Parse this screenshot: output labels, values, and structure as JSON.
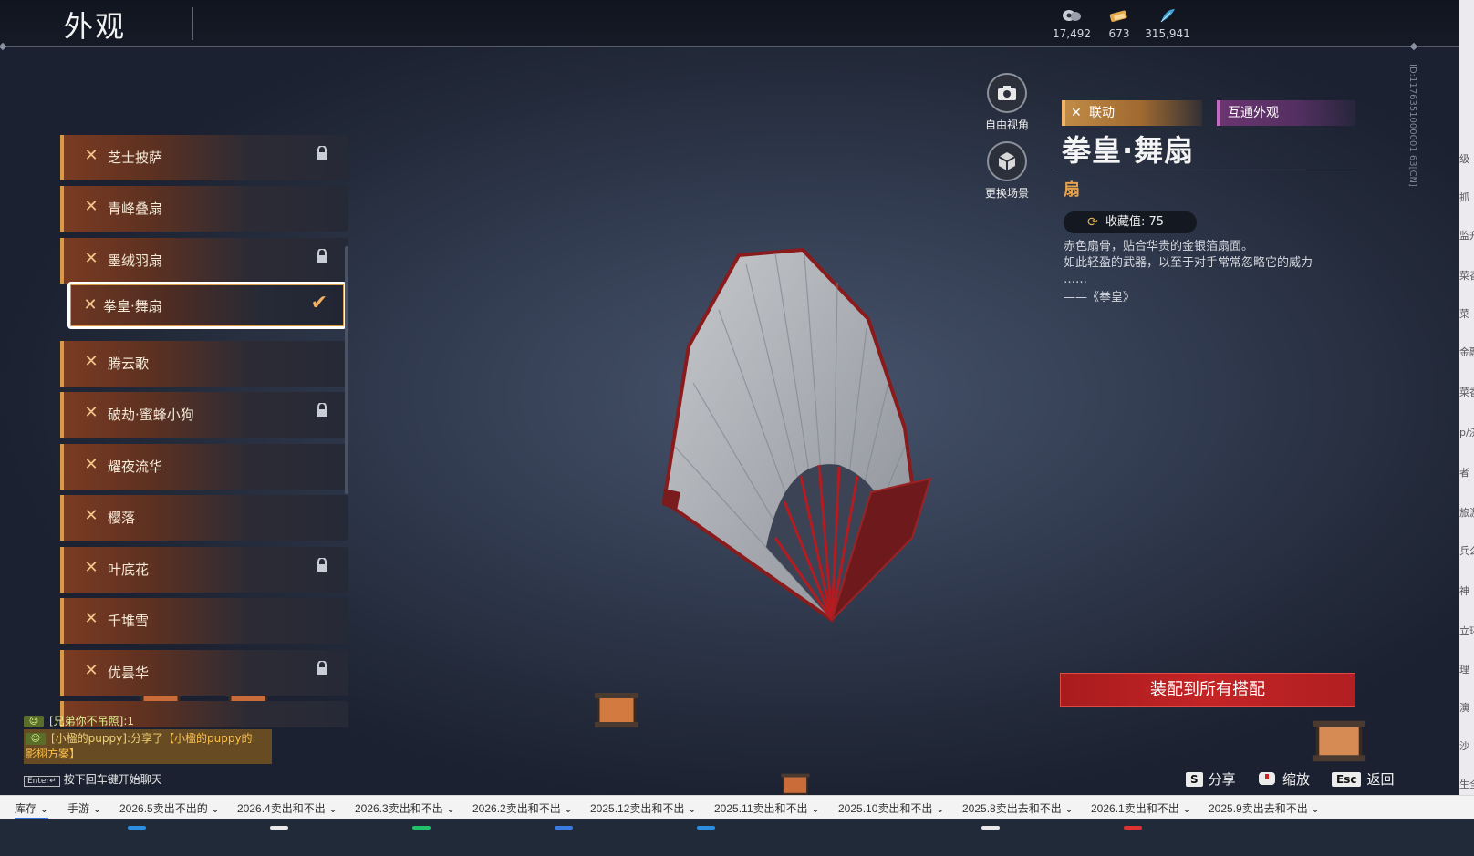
{
  "header": {
    "title": "外观",
    "currencies": [
      {
        "icon": "coin-icon",
        "value": "17,492"
      },
      {
        "icon": "ticket-icon",
        "value": "673"
      },
      {
        "icon": "feather-icon",
        "value": "315,941"
      }
    ]
  },
  "list": {
    "items": [
      {
        "label": "芝士披萨",
        "locked": true
      },
      {
        "label": "青峰叠扇",
        "locked": false
      },
      {
        "label": "墨绒羽扇",
        "locked": true
      },
      {
        "label": "拳皇·舞扇",
        "locked": false,
        "selected": true
      },
      {
        "label": "腾云歌",
        "locked": false
      },
      {
        "label": "破劫·蜜蜂小狗",
        "locked": true
      },
      {
        "label": "耀夜流华",
        "locked": false
      },
      {
        "label": "樱落",
        "locked": false
      },
      {
        "label": "叶底花",
        "locked": true
      },
      {
        "label": "千堆雪",
        "locked": false
      },
      {
        "label": "优昙华",
        "locked": true
      }
    ]
  },
  "camera": {
    "free_view": "自由视角",
    "change_scene": "更换场景"
  },
  "detail": {
    "tag_collab": "联动",
    "tag_shared": "互通外观",
    "name": "拳皇·舞扇",
    "type": "扇",
    "collect_label": "收藏值: 75",
    "desc_lines": [
      "赤色扇骨，贴合华贵的金银箔扇面。",
      "如此轻盈的武器，以至于对手常常忽略它的威力",
      "……"
    ],
    "quote": "——《拳皇》",
    "equip_button": "装配到所有搭配",
    "id_text": "ID:1176351000001 63[CN]"
  },
  "hotkeys": {
    "share_key": "S",
    "share": "分享",
    "zoom": "缩放",
    "back_key": "Esc",
    "back": "返回"
  },
  "chat": {
    "line1": "[兄弟你不吊照]:1",
    "line2_user": "[小楹的puppy]",
    "line2_mid": ":分享了",
    "line2_link": "【小楹的puppy的",
    "line2_cont": "影栩方案】",
    "enter_key": "Enter↵",
    "enter_hint": "按下回车键开始聊天"
  },
  "bookmarks": [
    "库存",
    "手游",
    "2026.5卖出不出的",
    "2026.4卖出和不出",
    "2026.3卖出和不出",
    "2026.2卖出和不出",
    "2025.12卖出和不出",
    "2025.11卖出和不出",
    "2025.10卖出和不出",
    "2025.8卖出去和不出",
    "2026.1卖出和不出",
    "2025.9卖出去和不出"
  ],
  "right_strip": [
    "级",
    "抓",
    "监升",
    "菜香",
    "菜",
    "金融",
    "菜香",
    "p/济",
    "者",
    "旅游",
    "兵么",
    "神",
    "立环",
    "理",
    "演",
    "沙",
    "生全"
  ],
  "colors": {
    "accent_orange": "#d79b48",
    "equip_red": "#c42426",
    "collab_gold": "#c08a46",
    "shared_purple": "#6a3470"
  }
}
